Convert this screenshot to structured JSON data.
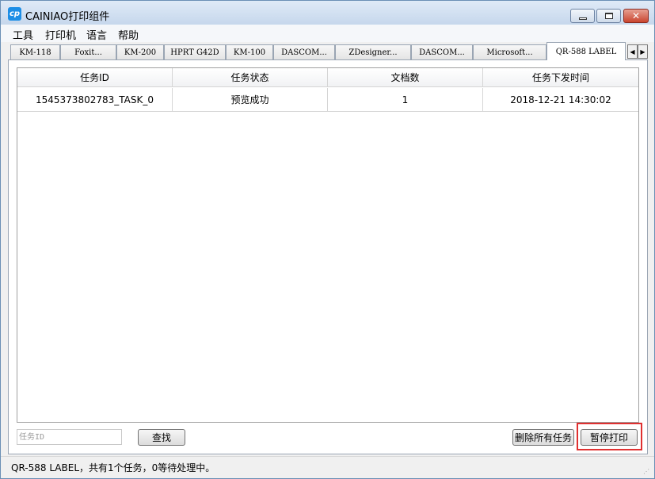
{
  "window": {
    "title": "CAINIAO打印组件",
    "icon": "cp-app-icon"
  },
  "menu": [
    "工具",
    "打印机",
    "语言",
    "帮助"
  ],
  "tabs": [
    {
      "label": "KM-118"
    },
    {
      "label": "Foxit..."
    },
    {
      "label": "KM-200"
    },
    {
      "label": "HPRT G42D"
    },
    {
      "label": "KM-100"
    },
    {
      "label": "DASCOM..."
    },
    {
      "label": "ZDesigner..."
    },
    {
      "label": "DASCOM..."
    },
    {
      "label": "Microsoft..."
    },
    {
      "label": "QR-588 LABEL"
    }
  ],
  "active_tab": "QR-588 LABEL",
  "table": {
    "columns": [
      "任务ID",
      "任务状态",
      "文档数",
      "任务下发时间"
    ],
    "rows": [
      [
        "1545373802783_TASK_0",
        "预览成功",
        "1",
        "2018-12-21 14:30:02"
      ]
    ]
  },
  "controls": {
    "search_placeholder": "任务ID",
    "search_button": "查找",
    "delete_all_button": "删除所有任务",
    "pause_button": "暂停打印"
  },
  "status": "QR-588 LABEL，共有1个任务，0等待处理中。",
  "colors": {
    "highlight": "#e03030",
    "app_icon": "#1c8ee6"
  }
}
